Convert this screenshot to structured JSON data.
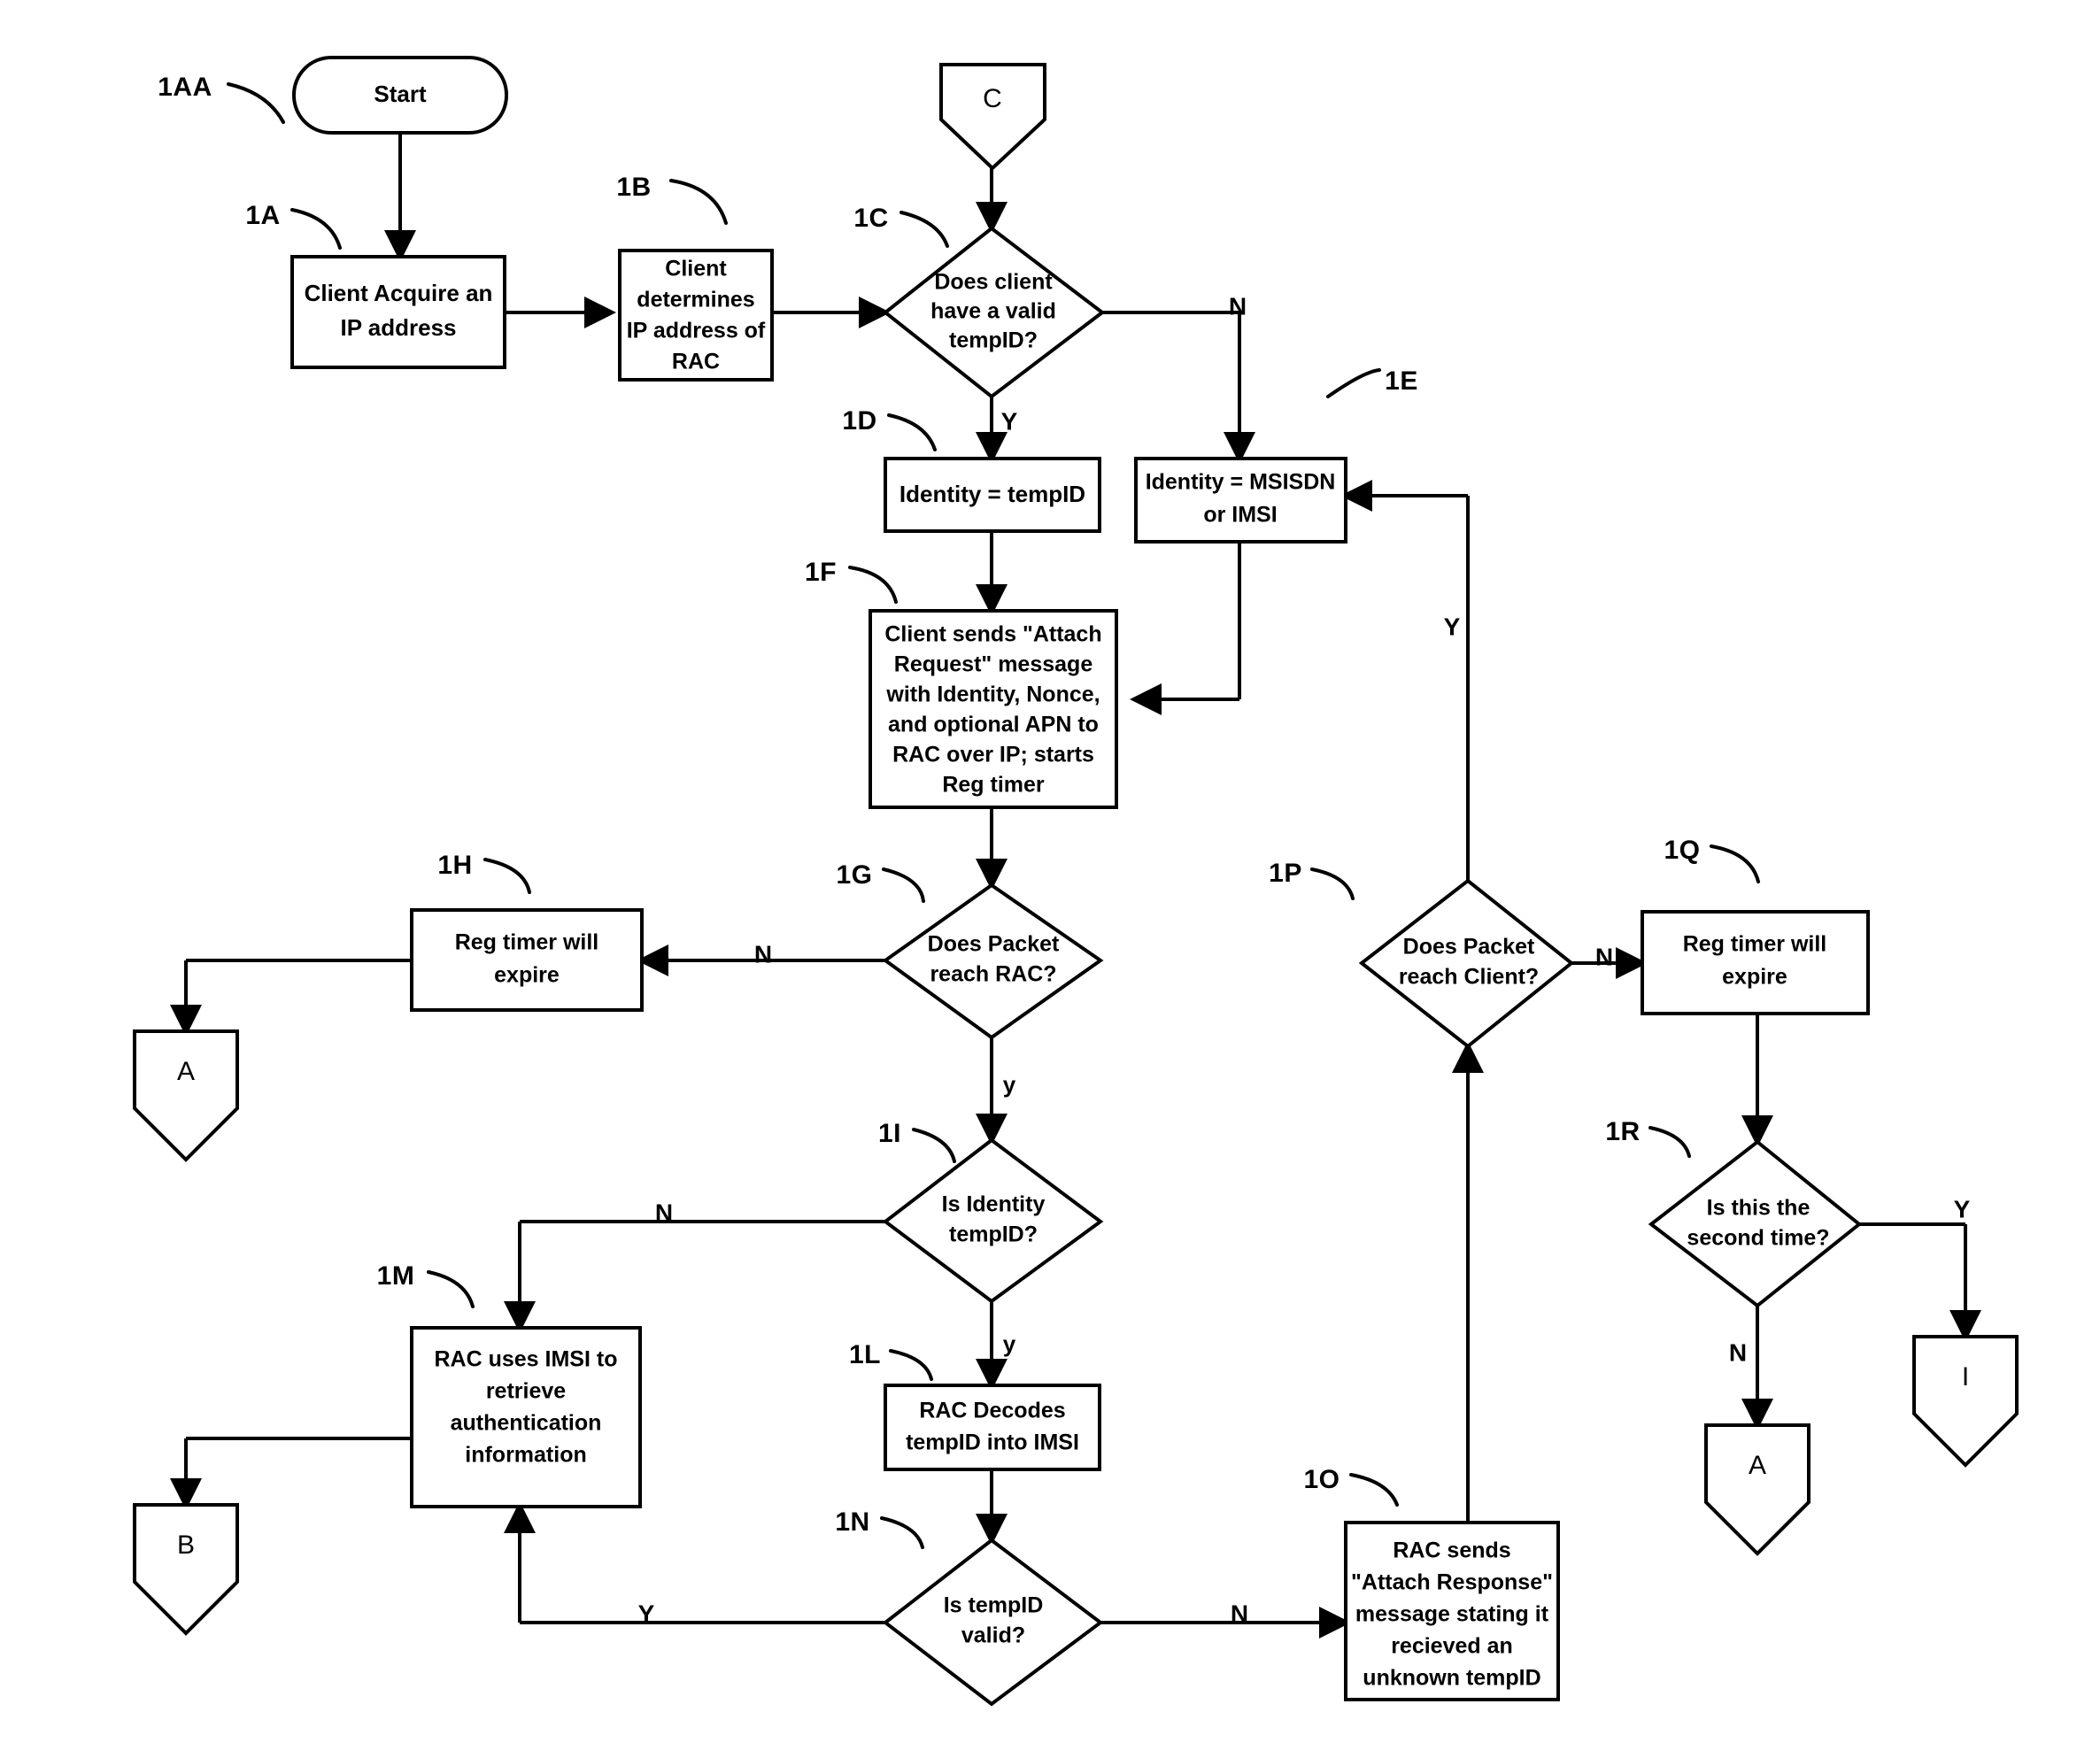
{
  "diagram": {
    "title": "Client Attach Request Flowchart",
    "type": "flowchart",
    "background_color": "#ffffff",
    "line_color": "#000000"
  },
  "nodes": {
    "start": {
      "ref": "1AA",
      "label": "Start",
      "shape": "terminator"
    },
    "acquire_ip": {
      "ref": "1A",
      "line1": "Client Acquire an",
      "line2": "IP address",
      "shape": "process"
    },
    "determine_rac": {
      "ref": "1B",
      "line1": "Client",
      "line2": "determines",
      "line3": "IP address of",
      "line4": "RAC",
      "shape": "process"
    },
    "valid_tempid": {
      "ref": "1C",
      "line1": "Does client",
      "line2": "have a valid",
      "line3": "tempID?",
      "shape": "decision"
    },
    "identity_tempid": {
      "ref": "1D",
      "line1": "Identity = tempID",
      "shape": "process"
    },
    "identity_msisdn": {
      "ref": "1E",
      "line1": "Identity = MSISDN",
      "line2": "or IMSI",
      "shape": "process"
    },
    "attach_request": {
      "ref": "1F",
      "line1": "Client sends \"Attach",
      "line2": "Request\" message",
      "line3": "with Identity, Nonce,",
      "line4": "and optional APN  to",
      "line5": "RAC over IP; starts",
      "line6": "Reg timer",
      "shape": "process"
    },
    "packet_reach_rac": {
      "ref": "1G",
      "line1": "Does Packet",
      "line2": "reach RAC?",
      "shape": "decision"
    },
    "reg_timer_expire_left": {
      "ref": "1H",
      "line1": "Reg timer will",
      "line2": "expire",
      "shape": "process"
    },
    "is_identity_tempid": {
      "ref": "1I",
      "line1": "Is Identity",
      "line2": "tempID?",
      "shape": "decision"
    },
    "rac_decodes": {
      "ref": "1L",
      "line1": "RAC Decodes",
      "line2": "tempID into IMSI",
      "shape": "process"
    },
    "rac_uses_imsi": {
      "ref": "1M",
      "line1": "RAC uses IMSI to",
      "line2": "retrieve",
      "line3": "authentication",
      "line4": "information",
      "shape": "process"
    },
    "is_tempid_valid": {
      "ref": "1N",
      "line1": "Is tempID",
      "line2": "valid?",
      "shape": "decision"
    },
    "rac_sends_response": {
      "ref": "1O",
      "line1": "RAC sends",
      "line2": "\"Attach Response\"",
      "line3": "message stating it",
      "line4": "recieved an",
      "line5": "unknown tempID",
      "shape": "process"
    },
    "packet_reach_client": {
      "ref": "1P",
      "line1": "Does Packet",
      "line2": "reach Client?",
      "shape": "decision"
    },
    "reg_timer_expire_right": {
      "ref": "1Q",
      "line1": "Reg timer will",
      "line2": "expire",
      "shape": "process"
    },
    "second_time": {
      "ref": "1R",
      "line1": "Is this the",
      "line2": "second time?",
      "shape": "decision"
    }
  },
  "connectors": {
    "c_in": {
      "label": "C",
      "shape": "pentagon-down"
    },
    "a_left": {
      "label": "A",
      "shape": "pentagon-down"
    },
    "b_left": {
      "label": "B",
      "shape": "pentagon-down"
    },
    "a_right": {
      "label": "A",
      "shape": "pentagon-down"
    },
    "i_right": {
      "label": "I",
      "shape": "pentagon-down"
    }
  },
  "edge_labels": {
    "valid_tempid_no": "N",
    "valid_tempid_yes": "Y",
    "packet_rac_no": "N",
    "packet_rac_yes": "y",
    "identity_tempid_no": "N",
    "identity_tempid_yes": "y",
    "tempid_valid_yes": "Y",
    "tempid_valid_no": "N",
    "packet_client_no": "N",
    "packet_client_yes": "Y",
    "second_time_yes": "Y",
    "second_time_no": "N"
  },
  "refs": {
    "r_1AA": "1AA",
    "r_1A": "1A",
    "r_1B": "1B",
    "r_1C": "1C",
    "r_1D": "1D",
    "r_1E": "1E",
    "r_1F": "1F",
    "r_1G": "1G",
    "r_1H": "1H",
    "r_1I": "1I",
    "r_1L": "1L",
    "r_1M": "1M",
    "r_1N": "1N",
    "r_1O": "1O",
    "r_1P": "1P",
    "r_1Q": "1Q",
    "r_1R": "1R"
  }
}
